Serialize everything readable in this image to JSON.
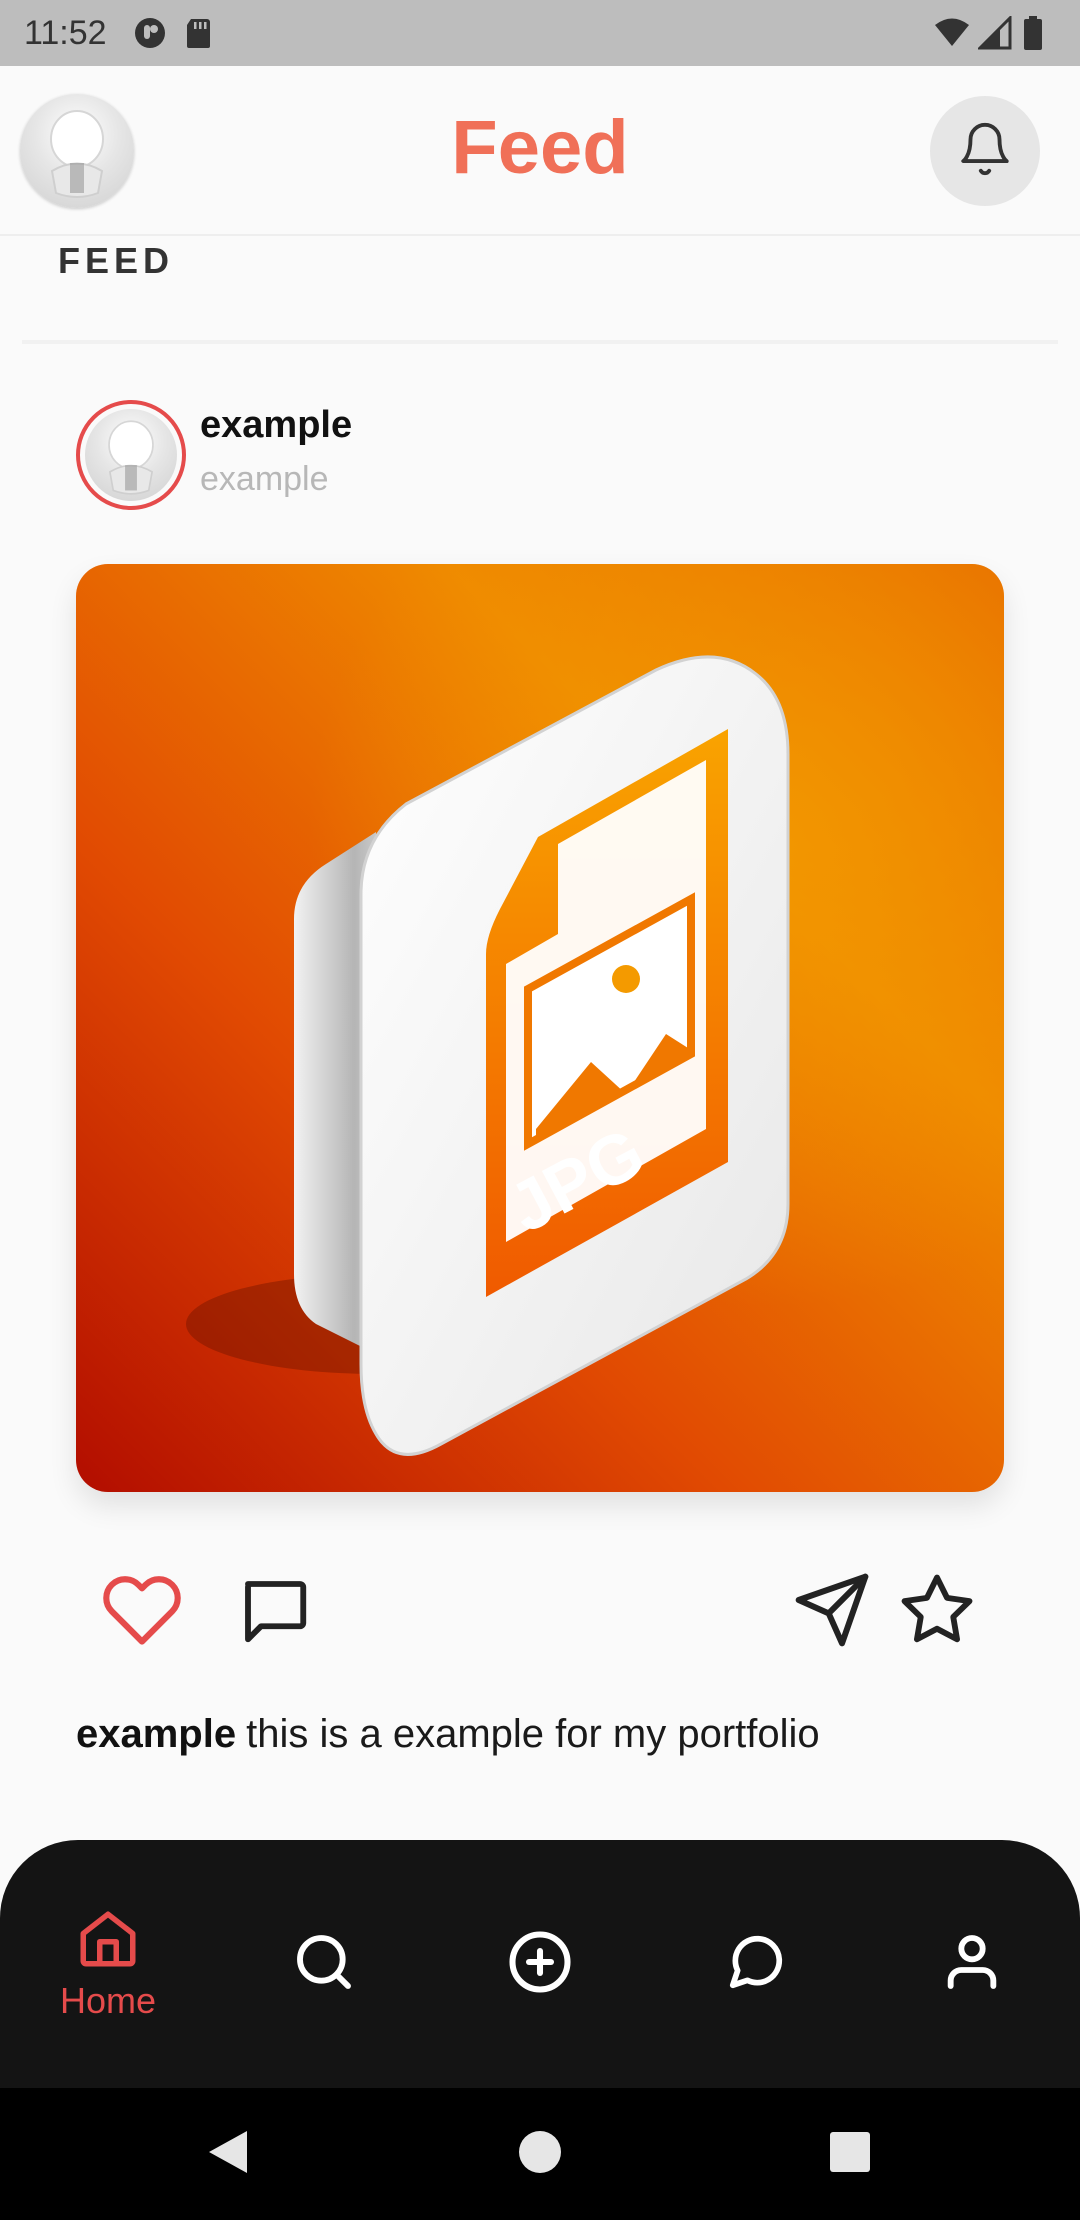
{
  "status_bar": {
    "time": "11:52",
    "icons": [
      "app-notification-icon",
      "sd-card-icon",
      "wifi-icon",
      "cell-signal-icon",
      "battery-icon"
    ]
  },
  "app_bar": {
    "title": "Feed",
    "title_color": "#f07058",
    "avatar_icon": "avatar",
    "bell_icon": "bell-icon"
  },
  "feed": {
    "section_label": "FEED",
    "post": {
      "username": "example",
      "handle": "example",
      "image_alt_text": "JPG",
      "image_icon": "jpg-file-icon",
      "caption_user": "example",
      "caption_text": "this is a example for my portfolio",
      "actions": {
        "like_icon": "heart-icon",
        "comment_icon": "comment-icon",
        "share_icon": "send-icon",
        "save_icon": "star-icon"
      }
    }
  },
  "bottom_nav": {
    "accent_color": "#e54b4b",
    "items": [
      {
        "label": "Home",
        "icon": "home-icon",
        "active": true
      },
      {
        "label": "",
        "icon": "search-icon",
        "active": false
      },
      {
        "label": "",
        "icon": "add-circle-icon",
        "active": false
      },
      {
        "label": "",
        "icon": "chat-icon",
        "active": false
      },
      {
        "label": "",
        "icon": "profile-icon",
        "active": false
      }
    ]
  },
  "system_nav": {
    "icons": [
      "back-icon",
      "home-circle-icon",
      "recents-icon"
    ]
  }
}
